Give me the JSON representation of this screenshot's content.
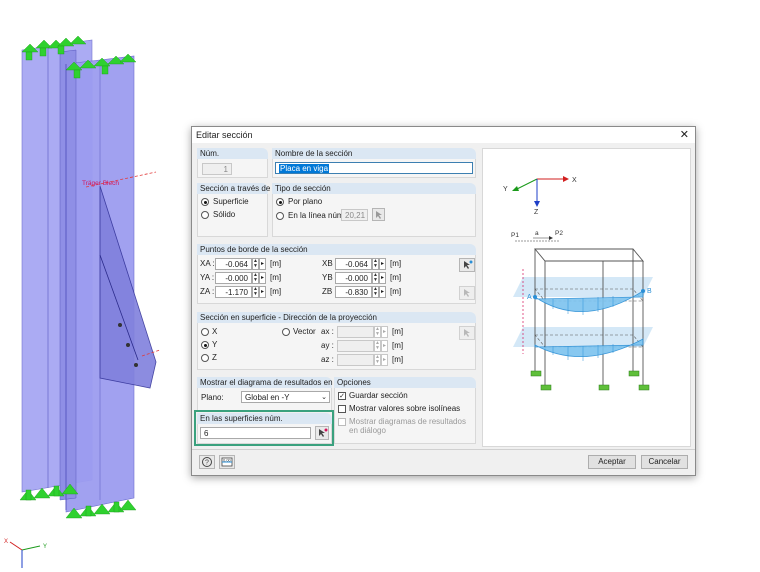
{
  "model": {
    "member_label": "Träger Blech",
    "axes": {
      "x": "X",
      "y": "Y",
      "z": "Z"
    }
  },
  "dialog": {
    "title": "Editar sección",
    "close_glyph": "✕",
    "num": {
      "label": "Núm.",
      "value": "1"
    },
    "name": {
      "label": "Nombre de la sección",
      "value": "Placa en viga"
    },
    "section_through": {
      "label": "Sección a través de",
      "options": [
        "Superficie",
        "Sólido"
      ],
      "selected": "Superficie"
    },
    "section_type": {
      "label": "Tipo de sección",
      "option_plane": "Por plano",
      "option_line": "En la línea núm.:",
      "line_value": "20,21",
      "selected": "Por plano"
    },
    "boundary_points": {
      "label": "Puntos de borde de la sección",
      "rows": [
        {
          "a_label": "XA :",
          "a_value": "-0.064",
          "b_label": "XB :",
          "b_value": "-0.064",
          "unit": "[m]"
        },
        {
          "a_label": "YA :",
          "a_value": "-0.000",
          "b_label": "YB :",
          "b_value": "-0.000",
          "unit": "[m]"
        },
        {
          "a_label": "ZA :",
          "a_value": "-1.170",
          "b_label": "ZB :",
          "b_value": "-0.830",
          "unit": "[m]"
        }
      ]
    },
    "projection": {
      "label": "Sección en superficie - Dirección de la proyección",
      "options": [
        "X",
        "Y",
        "Z"
      ],
      "selected": "Y",
      "vector_label": "Vector",
      "vector_rows": [
        {
          "label": "ax :",
          "value": "",
          "unit": "[m]"
        },
        {
          "label": "ay :",
          "value": "",
          "unit": "[m]"
        },
        {
          "label": "az :",
          "value": "",
          "unit": "[m]"
        }
      ]
    },
    "results_diagram": {
      "label": "Mostrar el diagrama de resultados en",
      "plane_label": "Plano:",
      "plane_value": "Global en -Y"
    },
    "surfaces": {
      "label": "En las superficies núm.",
      "value": "6"
    },
    "options": {
      "label": "Opciones",
      "save_section": {
        "label": "Guardar sección",
        "checked": true
      },
      "show_isolines": {
        "label": "Mostrar valores sobre isolíneas",
        "checked": false
      },
      "show_in_dialog": {
        "label": "Mostrar diagramas de resultados en diálogo",
        "checked": false
      }
    },
    "buttons": {
      "accept": "Aceptar",
      "cancel": "Cancelar"
    },
    "preview": {
      "labels": {
        "y": "Y",
        "x": "X",
        "z": "Z",
        "p1": "P1",
        "p2": "P2",
        "a": "a",
        "point_a": "A",
        "point_b": "B"
      },
      "colors": {
        "frame": "#555555",
        "diagram": "#2a8fd6",
        "support": "#4caf3c",
        "band": "#cfe6f6"
      }
    }
  },
  "colors": {
    "surface_fill": "#a9a9f5",
    "support": "#2fd12f",
    "highlight": "#3aa17e",
    "accent_line": "#d4145a"
  }
}
